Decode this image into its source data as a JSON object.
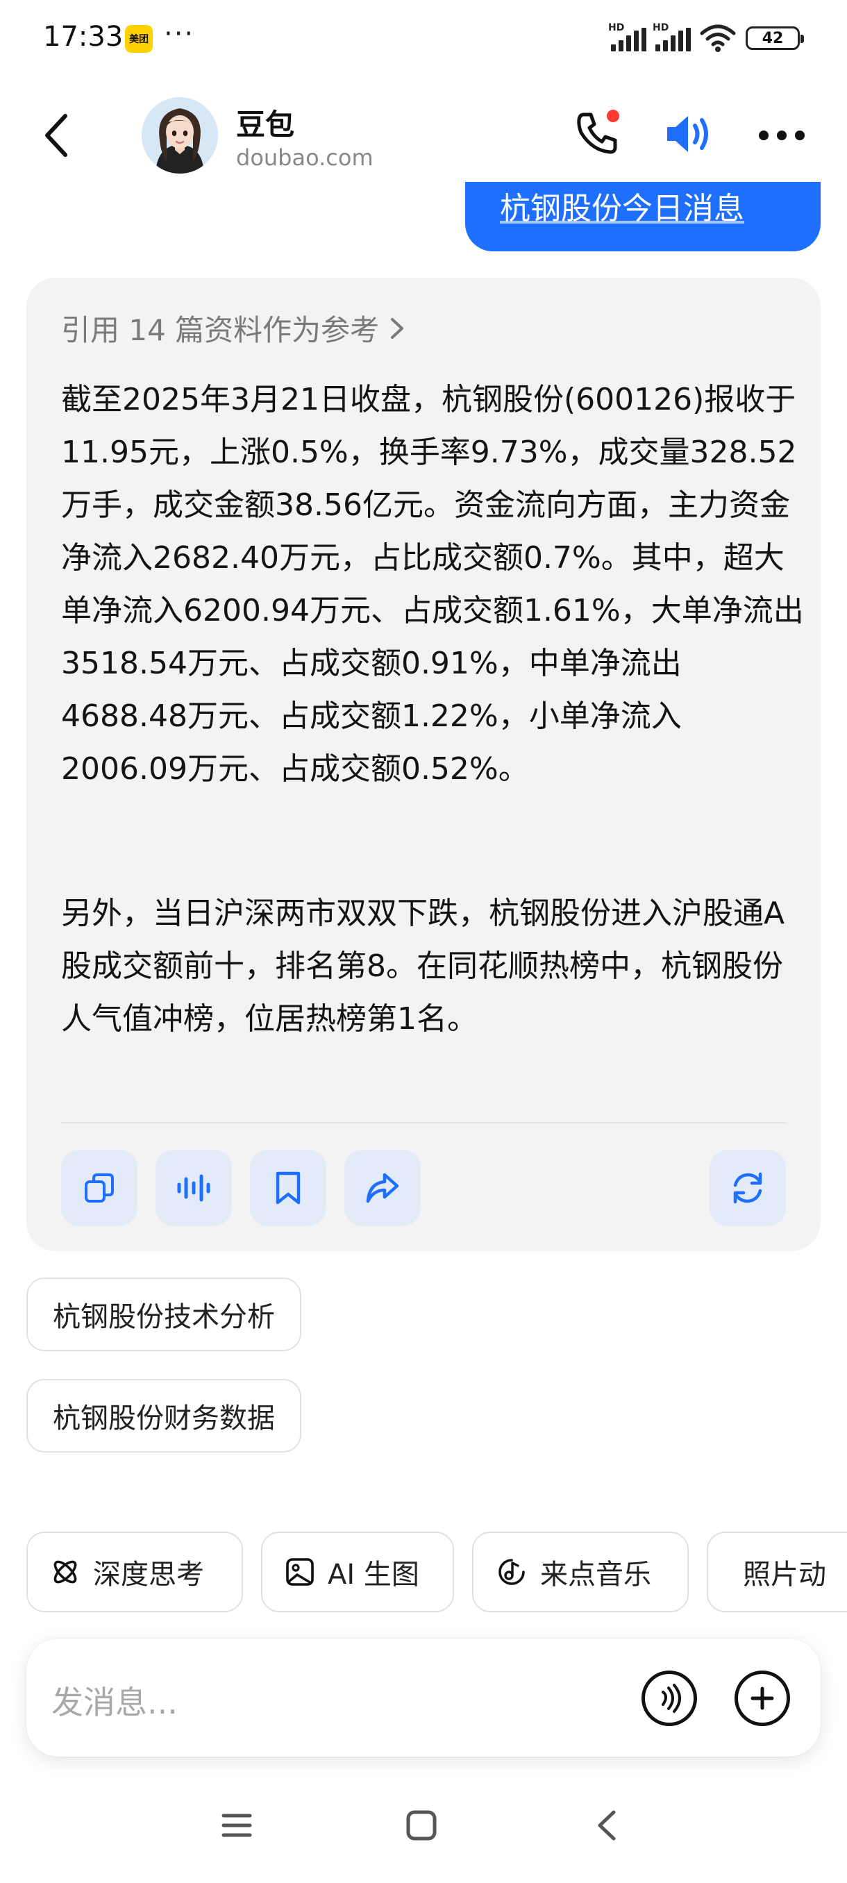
{
  "status_bar": {
    "time": "17:33",
    "app_badge": "美团",
    "more": "···",
    "network_label": "HD",
    "battery": "42"
  },
  "header": {
    "bot_name": "豆包",
    "bot_domain": "doubao.com",
    "icons": [
      "back-icon",
      "phone-icon",
      "speaker-icon",
      "more-icon"
    ],
    "accent_color": "#1f6fff",
    "notification_dot_color": "#ff3b30"
  },
  "user_message": {
    "text": "杭钢股份今日消息"
  },
  "answer": {
    "reference_label": "引用 14 篇资料作为参考",
    "paragraph_1": "截至2025年3月21日收盘，杭钢股份(600126)报收于11.95元，上涨0.5%，换手率9.73%，成交量328.52万手，成交金额38.56亿元。资金流向方面，主力资金净流入2682.40万元，占比成交额0.7%。其中，超大单净流入6200.94万元、占成交额1.61%，大单净流出3518.54万元、占成交额0.91%，中单净流出4688.48万元、占成交额1.22%，小单净流入2006.09万元、占成交额0.52%。",
    "paragraph_2": "另外，当日沪深两市双双下跌，杭钢股份进入沪股通A股成交额前十，排名第8。在同花顺热榜中，杭钢股份人气值冲榜，位居热榜第1名。",
    "actions": [
      "copy-icon",
      "voice-play-icon",
      "bookmark-icon",
      "share-icon",
      "regenerate-icon"
    ]
  },
  "suggestions": [
    {
      "label": "杭钢股份技术分析"
    },
    {
      "label": "杭钢股份财务数据"
    }
  ],
  "tools": [
    {
      "label": "深度思考",
      "icon": "atom-icon"
    },
    {
      "label": "AI 生图",
      "icon": "image-icon"
    },
    {
      "label": "来点音乐",
      "icon": "music-icon"
    },
    {
      "label": "照片动",
      "icon": "video-icon"
    }
  ],
  "input": {
    "placeholder": "发消息..."
  },
  "nav_bar": {
    "icons": [
      "menu-icon",
      "home-icon",
      "back-nav-icon"
    ]
  }
}
